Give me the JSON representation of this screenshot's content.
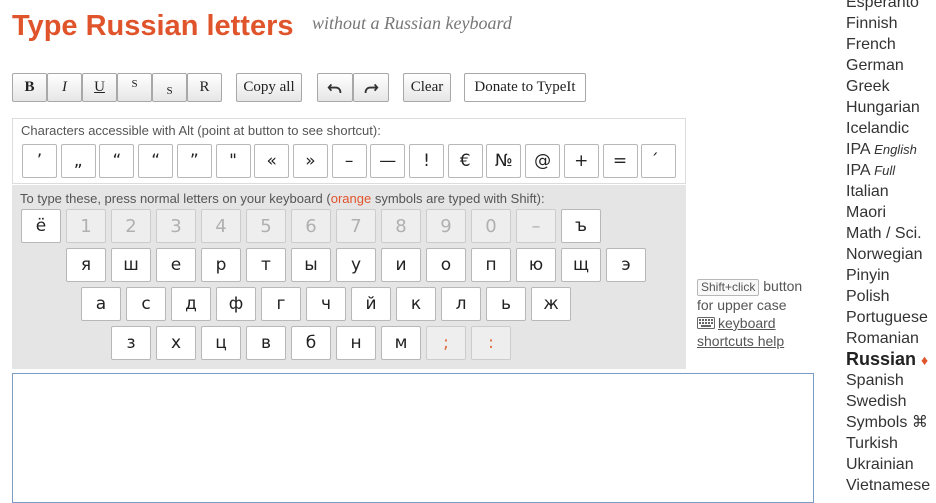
{
  "header": {
    "title": "Type Russian letters",
    "subtitle": "without a Russian keyboard"
  },
  "toolbar": {
    "bold": "B",
    "italic": "I",
    "underline": "U",
    "superscript": "S",
    "subscript": "S",
    "reset": "R",
    "copy_all": "Copy all",
    "undo_icon": "undo-arrow",
    "redo_icon": "redo-arrow",
    "clear": "Clear",
    "donate": "Donate to TypeIt"
  },
  "alt_panel": {
    "label": "Characters accessible with Alt (point at button to see shortcut):",
    "keys": [
      "’",
      "„",
      "“",
      "“",
      "”",
      "\"",
      "«",
      "»",
      "–",
      "—",
      "!",
      "€",
      "№",
      "@",
      "+",
      "=",
      "́"
    ]
  },
  "keyboard": {
    "label_before": "To type these, press normal letters on your keyboard (",
    "label_orange": "orange",
    "label_after": " symbols are typed with Shift):",
    "row1": [
      "ё",
      "1",
      "2",
      "3",
      "4",
      "5",
      "6",
      "7",
      "8",
      "9",
      "0",
      "–",
      "ъ"
    ],
    "row2": [
      "я",
      "ш",
      "е",
      "р",
      "т",
      "ы",
      "у",
      "и",
      "о",
      "п",
      "ю",
      "щ",
      "э"
    ],
    "row3": [
      "а",
      "с",
      "д",
      "ф",
      "г",
      "ч",
      "й",
      "к",
      "л",
      "ь",
      "ж"
    ],
    "row4": [
      "з",
      "х",
      "ц",
      "в",
      "б",
      "н",
      "м",
      ";",
      ":"
    ]
  },
  "hint": {
    "shift_click": "Shift+click",
    "upper_case": "button for upper case",
    "keyboard_icon": "keyboard-icon",
    "shortcuts_help": "keyboard shortcuts help"
  },
  "editor": {
    "value": ""
  },
  "languages": [
    {
      "name": "Esperanto",
      "sub": ""
    },
    {
      "name": "Finnish",
      "sub": ""
    },
    {
      "name": "French",
      "sub": ""
    },
    {
      "name": "German",
      "sub": ""
    },
    {
      "name": "Greek",
      "sub": ""
    },
    {
      "name": "Hungarian",
      "sub": ""
    },
    {
      "name": "Icelandic",
      "sub": ""
    },
    {
      "name": "IPA",
      "sub": "English"
    },
    {
      "name": "IPA",
      "sub": "Full"
    },
    {
      "name": "Italian",
      "sub": ""
    },
    {
      "name": "Maori",
      "sub": ""
    },
    {
      "name": "Math / Sci.",
      "sub": ""
    },
    {
      "name": "Norwegian",
      "sub": ""
    },
    {
      "name": "Pinyin",
      "sub": ""
    },
    {
      "name": "Polish",
      "sub": ""
    },
    {
      "name": "Portuguese",
      "sub": ""
    },
    {
      "name": "Romanian",
      "sub": ""
    },
    {
      "name": "Russian",
      "sub": "",
      "current": true,
      "marker": "♦"
    },
    {
      "name": "Spanish",
      "sub": ""
    },
    {
      "name": "Swedish",
      "sub": ""
    },
    {
      "name": "Symbols",
      "sub": "",
      "marker": "⌘"
    },
    {
      "name": "Turkish",
      "sub": ""
    },
    {
      "name": "Ukrainian",
      "sub": ""
    },
    {
      "name": "Vietnamese",
      "sub": ""
    }
  ],
  "colors": {
    "accent": "#e0542c",
    "panel": "#e5e5e5",
    "editor_border": "#7a9cc6"
  }
}
